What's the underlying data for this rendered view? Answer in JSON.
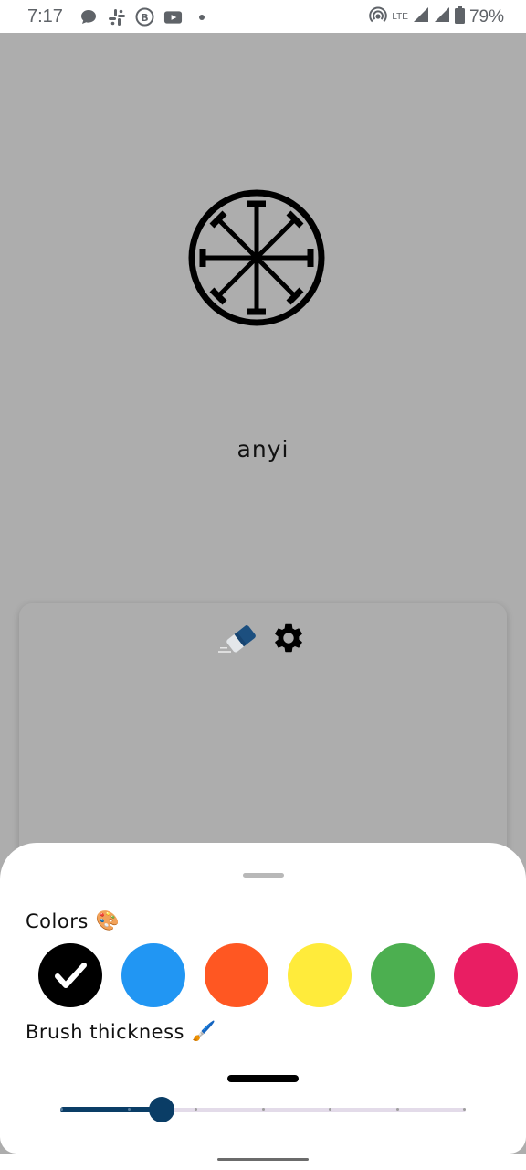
{
  "status_bar": {
    "time": "7:17",
    "network": "LTE",
    "battery": "79%",
    "notification_icons": [
      "chat-bubble-icon",
      "slack-icon",
      "b-badge-icon",
      "youtube-icon",
      "dot-icon"
    ]
  },
  "symbol": {
    "icon": "circle-asterisk-glyph"
  },
  "word": "anyi",
  "toolbar": {
    "eraser_icon": "eraser-icon",
    "settings_icon": "gear-icon"
  },
  "sheet": {
    "colors_label": "Colors",
    "colors_emoji": "🎨",
    "brush_label": "Brush thickness",
    "brush_emoji": "🖌️",
    "swatches": [
      {
        "color": "#000000",
        "selected": true
      },
      {
        "color": "#2196f3",
        "selected": false
      },
      {
        "color": "#ff5722",
        "selected": false
      },
      {
        "color": "#ffeb3b",
        "selected": false
      },
      {
        "color": "#4caf50",
        "selected": false
      },
      {
        "color": "#e91e63",
        "selected": false
      }
    ],
    "slider": {
      "value_fraction": 0.25,
      "ticks": 7
    }
  },
  "colors": {
    "background": "#adadad",
    "accent": "#0a3d66"
  }
}
